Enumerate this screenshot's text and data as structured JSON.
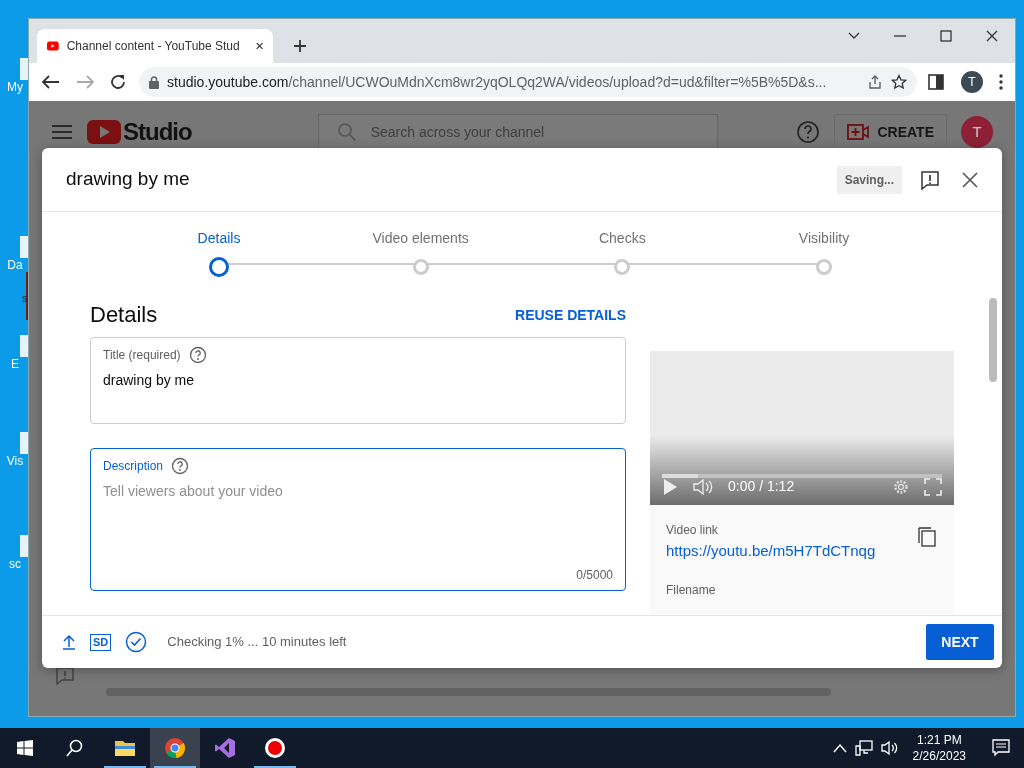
{
  "desktop": {
    "icons": [
      {
        "label": "My"
      },
      {
        "label": "Da"
      },
      {
        "label": "E"
      },
      {
        "label": "Vis"
      },
      {
        "label": "sc"
      }
    ],
    "background_window": {
      "label": "s"
    }
  },
  "browser": {
    "tabs": [
      {
        "title": "Channel content - YouTube Stud",
        "selected": true
      }
    ],
    "url": {
      "host": "studio.youtube.com",
      "path": "/channel/UCWOuMdnXcm8wr2yqOLQq2WA/videos/upload?d=ud&filter=%5B%5D&s..."
    },
    "profile": "T"
  },
  "studio": {
    "logo": "Studio",
    "search": {
      "placeholder": "Search across your channel"
    },
    "create": "CREATE",
    "avatar": "T"
  },
  "dialog": {
    "title": "drawing by me",
    "status": "Saving...",
    "steps": [
      {
        "label": "Details",
        "selected": true
      },
      {
        "label": "Video elements",
        "selected": false
      },
      {
        "label": "Checks",
        "selected": false
      },
      {
        "label": "Visibility",
        "selected": false
      }
    ],
    "heading": "Details",
    "reuse": "REUSE DETAILS",
    "fields": [
      {
        "label": "Title (required)",
        "value": "drawing by me",
        "focused": false
      },
      {
        "label": "Description",
        "placeholder": "Tell viewers about your video",
        "counter": "0/5000",
        "focused": true
      }
    ],
    "video": {
      "time": "0:00 / 1:12",
      "level": 0.13,
      "link_label": "Video link",
      "link": "https://youtu.be/m5H7TdCTnqg",
      "filename_label": "Filename"
    },
    "footer": {
      "quality": "SD",
      "status": "Checking 1% ... 10 minutes left",
      "next": "NEXT"
    }
  },
  "taskbar": {
    "apps": [
      {
        "kind": "explorer",
        "running": true,
        "selected": false
      },
      {
        "kind": "chrome",
        "running": true,
        "selected": true
      },
      {
        "kind": "studio",
        "running": false,
        "selected": false
      },
      {
        "kind": "recorder",
        "running": true,
        "selected": false
      }
    ],
    "time": "1:21 PM",
    "date": "2/26/2023"
  }
}
